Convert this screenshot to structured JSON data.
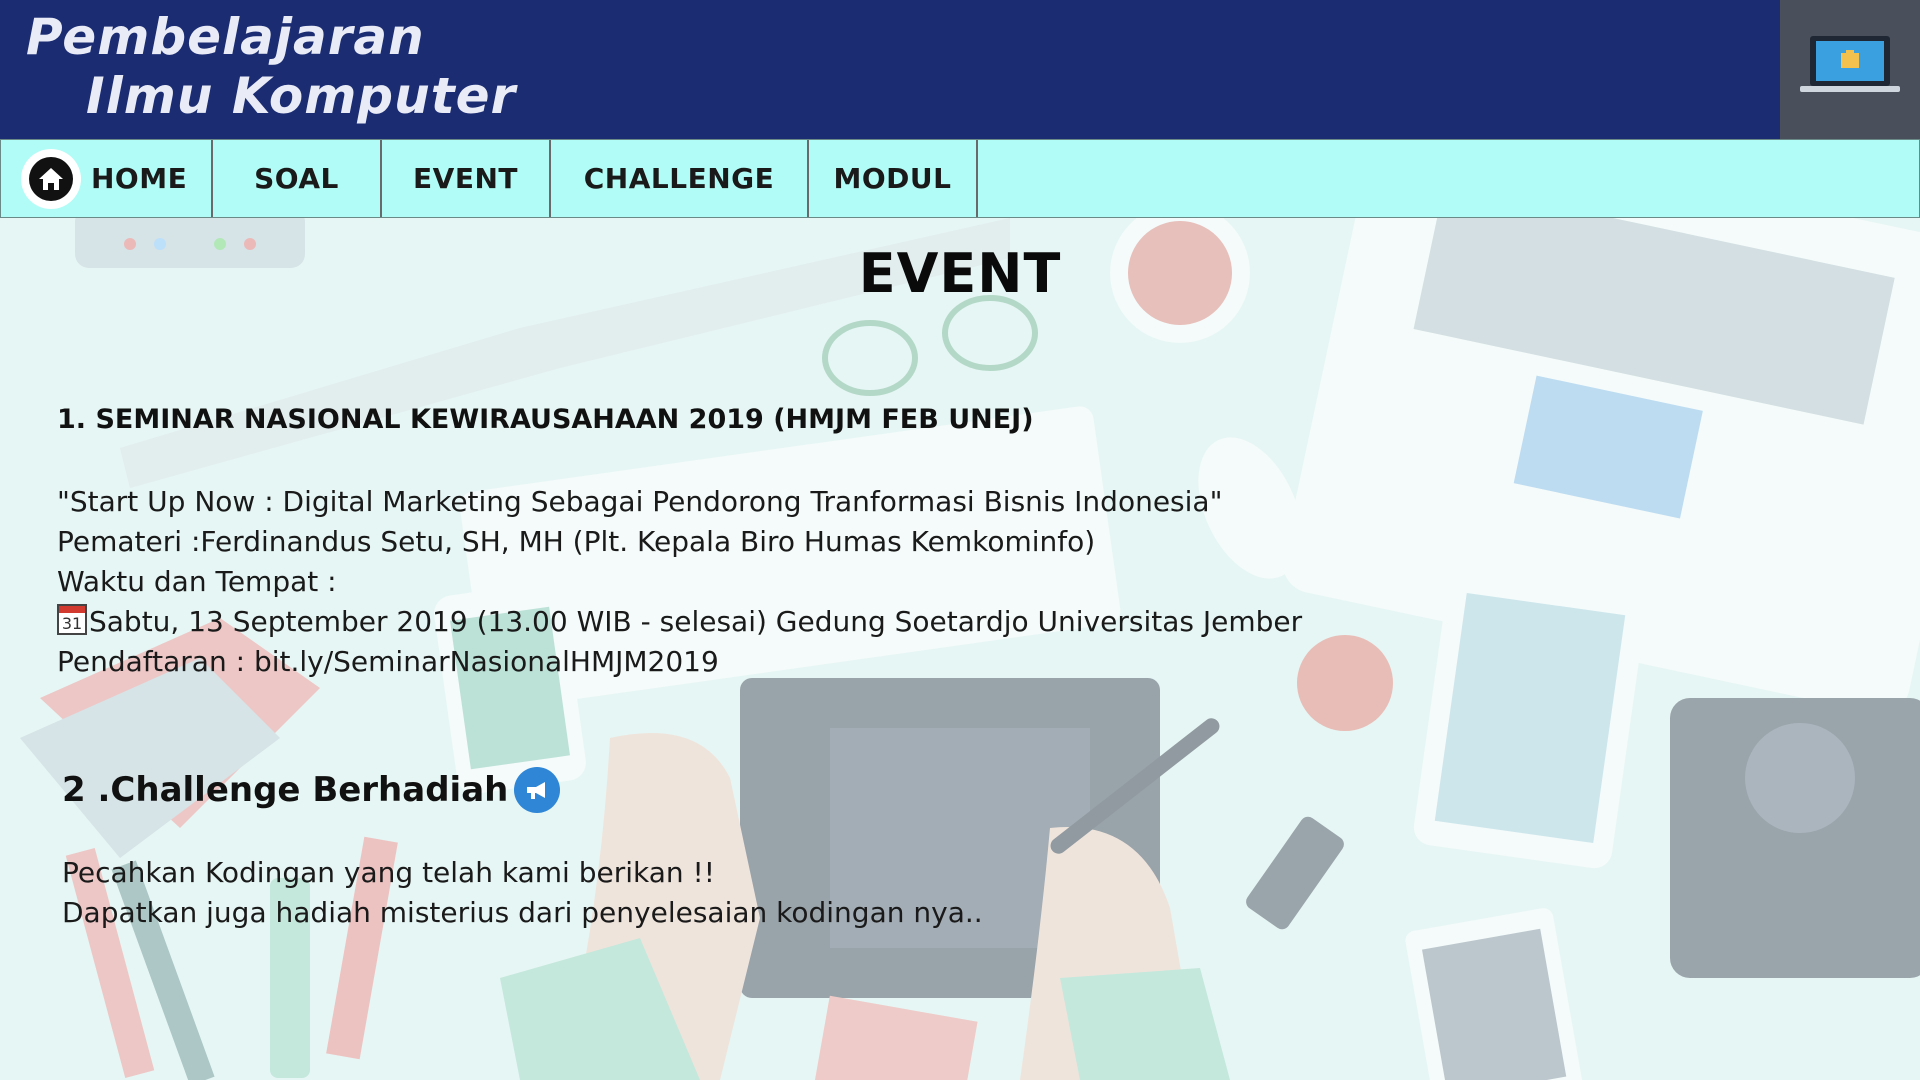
{
  "header": {
    "brand_line1": "Pembelajaran",
    "brand_line2": "Ilmu Komputer",
    "logo_icon": "laptop-icon",
    "bg_color": "#1b2c73"
  },
  "nav": {
    "bg_color": "#b1fcf6",
    "items": [
      {
        "label": "HOME",
        "icon": "home-icon"
      },
      {
        "label": "SOAL"
      },
      {
        "label": "EVENT"
      },
      {
        "label": "CHALLENGE"
      },
      {
        "label": "MODUL"
      }
    ]
  },
  "main": {
    "title": "EVENT",
    "events": [
      {
        "title": "1. SEMINAR NASIONAL KEWIRAUSAHAAN 2019 (HMJM FEB UNEJ)",
        "lines": [
          "\"Start Up Now : Digital Marketing Sebagai Pendorong Tranformasi Bisnis Indonesia\"",
          "Pemateri :Ferdinandus Setu, SH, MH (Plt. Kepala Biro Humas Kemkominfo)",
          "Waktu dan Tempat :",
          "Sabtu, 13 September 2019 (13.00 WIB - selesai) Gedung Soetardjo Universitas Jember",
          "Pendaftaran : bit.ly/SeminarNasionalHMJM2019"
        ],
        "calendar_icon_day": "31"
      },
      {
        "title": "2 .Challenge Berhadiah",
        "icon": "megaphone-icon",
        "lines": [
          "Pecahkan Kodingan yang telah kami berikan !!",
          "Dapatkan juga hadiah misterius dari penyelesaian kodingan nya.."
        ]
      }
    ]
  }
}
